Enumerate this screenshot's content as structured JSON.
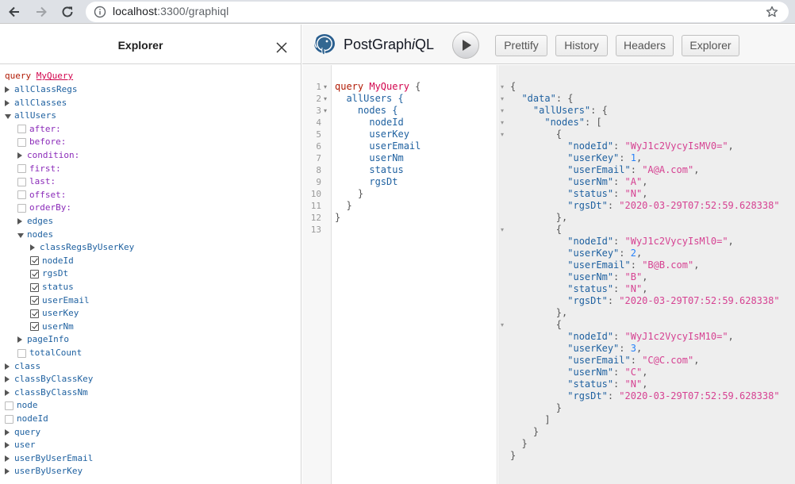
{
  "browser": {
    "url_host": "localhost",
    "url_rest": ":3300/graphiql"
  },
  "explorer": {
    "title": "Explorer",
    "root": {
      "keyword": "query",
      "name": "MyQuery"
    },
    "rows": [
      {
        "t": "allClassRegs",
        "k": "fld",
        "c": "collapsed"
      },
      {
        "t": "allClasses",
        "k": "fld",
        "c": "collapsed"
      },
      {
        "t": "allUsers",
        "k": "fld",
        "c": "expanded"
      },
      {
        "t": "after:",
        "k": "arg",
        "c": "unchecked"
      },
      {
        "t": "before:",
        "k": "arg",
        "c": "unchecked"
      },
      {
        "t": "condition:",
        "k": "arg",
        "c": "collapsed"
      },
      {
        "t": "first:",
        "k": "arg",
        "c": "unchecked"
      },
      {
        "t": "last:",
        "k": "arg",
        "c": "unchecked"
      },
      {
        "t": "offset:",
        "k": "arg",
        "c": "unchecked"
      },
      {
        "t": "orderBy:",
        "k": "arg",
        "c": "unchecked"
      },
      {
        "t": "edges",
        "k": "fld",
        "c": "collapsed"
      },
      {
        "t": "nodes",
        "k": "fld",
        "c": "expanded"
      },
      {
        "t": "classRegsByUserKey",
        "k": "fld",
        "c": "collapsed"
      },
      {
        "t": "nodeId",
        "k": "fld",
        "c": "checked"
      },
      {
        "t": "rgsDt",
        "k": "fld",
        "c": "checked"
      },
      {
        "t": "status",
        "k": "fld",
        "c": "checked"
      },
      {
        "t": "userEmail",
        "k": "fld",
        "c": "checked"
      },
      {
        "t": "userKey",
        "k": "fld",
        "c": "checked"
      },
      {
        "t": "userNm",
        "k": "fld",
        "c": "checked"
      },
      {
        "t": "pageInfo",
        "k": "fld",
        "c": "collapsed"
      },
      {
        "t": "totalCount",
        "k": "fld",
        "c": "unchecked"
      },
      {
        "t": "class",
        "k": "fld",
        "c": "collapsed"
      },
      {
        "t": "classByClassKey",
        "k": "fld",
        "c": "collapsed"
      },
      {
        "t": "classByClassNm",
        "k": "fld",
        "c": "collapsed"
      },
      {
        "t": "node",
        "k": "fld",
        "c": "unchecked"
      },
      {
        "t": "nodeId",
        "k": "fld",
        "c": "unchecked"
      },
      {
        "t": "query",
        "k": "fld",
        "c": "collapsed"
      },
      {
        "t": "user",
        "k": "fld",
        "c": "collapsed"
      },
      {
        "t": "userByUserEmail",
        "k": "fld",
        "c": "collapsed"
      },
      {
        "t": "userByUserKey",
        "k": "fld",
        "c": "collapsed"
      }
    ]
  },
  "toolbar": {
    "brand_prefix": "PostGraph",
    "brand_italic": "i",
    "brand_suffix": "QL",
    "buttons": [
      "Prettify",
      "History",
      "Headers",
      "Explorer"
    ]
  },
  "editor": {
    "lines": [
      [
        {
          "s": "query ",
          "c": "kw"
        },
        {
          "s": "MyQuery",
          "c": "qn"
        },
        {
          "s": " {",
          "c": "p"
        }
      ],
      [
        {
          "s": "  allUsers {",
          "c": "f"
        }
      ],
      [
        {
          "s": "    nodes {",
          "c": "f"
        }
      ],
      [
        {
          "s": "      nodeId",
          "c": "f"
        }
      ],
      [
        {
          "s": "      userKey",
          "c": "f"
        }
      ],
      [
        {
          "s": "      userEmail",
          "c": "f"
        }
      ],
      [
        {
          "s": "      userNm",
          "c": "f"
        }
      ],
      [
        {
          "s": "      status",
          "c": "f"
        }
      ],
      [
        {
          "s": "      rgsDt",
          "c": "f"
        }
      ],
      [
        {
          "s": "    }",
          "c": "p"
        }
      ],
      [
        {
          "s": "  }",
          "c": "p"
        }
      ],
      [
        {
          "s": "}",
          "c": "p"
        }
      ],
      [
        {
          "s": "",
          "c": "p"
        }
      ]
    ],
    "fold_lines": [
      1,
      2,
      3
    ]
  },
  "result": {
    "lines": [
      [
        {
          "s": "{",
          "c": "p"
        }
      ],
      [
        {
          "s": "  ",
          "c": "p"
        },
        {
          "s": "\"data\"",
          "c": "k"
        },
        {
          "s": ": {",
          "c": "p"
        }
      ],
      [
        {
          "s": "    ",
          "c": "p"
        },
        {
          "s": "\"allUsers\"",
          "c": "k"
        },
        {
          "s": ": {",
          "c": "p"
        }
      ],
      [
        {
          "s": "      ",
          "c": "p"
        },
        {
          "s": "\"nodes\"",
          "c": "k"
        },
        {
          "s": ": [",
          "c": "p"
        }
      ],
      [
        {
          "s": "        {",
          "c": "p"
        }
      ],
      [
        {
          "s": "          ",
          "c": "p"
        },
        {
          "s": "\"nodeId\"",
          "c": "k"
        },
        {
          "s": ": ",
          "c": "p"
        },
        {
          "s": "\"WyJ1c2VycyIsMV0=\"",
          "c": "s"
        },
        {
          "s": ",",
          "c": "p"
        }
      ],
      [
        {
          "s": "          ",
          "c": "p"
        },
        {
          "s": "\"userKey\"",
          "c": "k"
        },
        {
          "s": ": ",
          "c": "p"
        },
        {
          "s": "1",
          "c": "n"
        },
        {
          "s": ",",
          "c": "p"
        }
      ],
      [
        {
          "s": "          ",
          "c": "p"
        },
        {
          "s": "\"userEmail\"",
          "c": "k"
        },
        {
          "s": ": ",
          "c": "p"
        },
        {
          "s": "\"A@A.com\"",
          "c": "s"
        },
        {
          "s": ",",
          "c": "p"
        }
      ],
      [
        {
          "s": "          ",
          "c": "p"
        },
        {
          "s": "\"userNm\"",
          "c": "k"
        },
        {
          "s": ": ",
          "c": "p"
        },
        {
          "s": "\"A\"",
          "c": "s"
        },
        {
          "s": ",",
          "c": "p"
        }
      ],
      [
        {
          "s": "          ",
          "c": "p"
        },
        {
          "s": "\"status\"",
          "c": "k"
        },
        {
          "s": ": ",
          "c": "p"
        },
        {
          "s": "\"N\"",
          "c": "s"
        },
        {
          "s": ",",
          "c": "p"
        }
      ],
      [
        {
          "s": "          ",
          "c": "p"
        },
        {
          "s": "\"rgsDt\"",
          "c": "k"
        },
        {
          "s": ": ",
          "c": "p"
        },
        {
          "s": "\"2020-03-29T07:52:59.628338\"",
          "c": "s"
        }
      ],
      [
        {
          "s": "        },",
          "c": "p"
        }
      ],
      [
        {
          "s": "        {",
          "c": "p"
        }
      ],
      [
        {
          "s": "          ",
          "c": "p"
        },
        {
          "s": "\"nodeId\"",
          "c": "k"
        },
        {
          "s": ": ",
          "c": "p"
        },
        {
          "s": "\"WyJ1c2VycyIsMl0=\"",
          "c": "s"
        },
        {
          "s": ",",
          "c": "p"
        }
      ],
      [
        {
          "s": "          ",
          "c": "p"
        },
        {
          "s": "\"userKey\"",
          "c": "k"
        },
        {
          "s": ": ",
          "c": "p"
        },
        {
          "s": "2",
          "c": "n"
        },
        {
          "s": ",",
          "c": "p"
        }
      ],
      [
        {
          "s": "          ",
          "c": "p"
        },
        {
          "s": "\"userEmail\"",
          "c": "k"
        },
        {
          "s": ": ",
          "c": "p"
        },
        {
          "s": "\"B@B.com\"",
          "c": "s"
        },
        {
          "s": ",",
          "c": "p"
        }
      ],
      [
        {
          "s": "          ",
          "c": "p"
        },
        {
          "s": "\"userNm\"",
          "c": "k"
        },
        {
          "s": ": ",
          "c": "p"
        },
        {
          "s": "\"B\"",
          "c": "s"
        },
        {
          "s": ",",
          "c": "p"
        }
      ],
      [
        {
          "s": "          ",
          "c": "p"
        },
        {
          "s": "\"status\"",
          "c": "k"
        },
        {
          "s": ": ",
          "c": "p"
        },
        {
          "s": "\"N\"",
          "c": "s"
        },
        {
          "s": ",",
          "c": "p"
        }
      ],
      [
        {
          "s": "          ",
          "c": "p"
        },
        {
          "s": "\"rgsDt\"",
          "c": "k"
        },
        {
          "s": ": ",
          "c": "p"
        },
        {
          "s": "\"2020-03-29T07:52:59.628338\"",
          "c": "s"
        }
      ],
      [
        {
          "s": "        },",
          "c": "p"
        }
      ],
      [
        {
          "s": "        {",
          "c": "p"
        }
      ],
      [
        {
          "s": "          ",
          "c": "p"
        },
        {
          "s": "\"nodeId\"",
          "c": "k"
        },
        {
          "s": ": ",
          "c": "p"
        },
        {
          "s": "\"WyJ1c2VycyIsM10=\"",
          "c": "s"
        },
        {
          "s": ",",
          "c": "p"
        }
      ],
      [
        {
          "s": "          ",
          "c": "p"
        },
        {
          "s": "\"userKey\"",
          "c": "k"
        },
        {
          "s": ": ",
          "c": "p"
        },
        {
          "s": "3",
          "c": "n"
        },
        {
          "s": ",",
          "c": "p"
        }
      ],
      [
        {
          "s": "          ",
          "c": "p"
        },
        {
          "s": "\"userEmail\"",
          "c": "k"
        },
        {
          "s": ": ",
          "c": "p"
        },
        {
          "s": "\"C@C.com\"",
          "c": "s"
        },
        {
          "s": ",",
          "c": "p"
        }
      ],
      [
        {
          "s": "          ",
          "c": "p"
        },
        {
          "s": "\"userNm\"",
          "c": "k"
        },
        {
          "s": ": ",
          "c": "p"
        },
        {
          "s": "\"C\"",
          "c": "s"
        },
        {
          "s": ",",
          "c": "p"
        }
      ],
      [
        {
          "s": "          ",
          "c": "p"
        },
        {
          "s": "\"status\"",
          "c": "k"
        },
        {
          "s": ": ",
          "c": "p"
        },
        {
          "s": "\"N\"",
          "c": "s"
        },
        {
          "s": ",",
          "c": "p"
        }
      ],
      [
        {
          "s": "          ",
          "c": "p"
        },
        {
          "s": "\"rgsDt\"",
          "c": "k"
        },
        {
          "s": ": ",
          "c": "p"
        },
        {
          "s": "\"2020-03-29T07:52:59.628338\"",
          "c": "s"
        }
      ],
      [
        {
          "s": "        }",
          "c": "p"
        }
      ],
      [
        {
          "s": "      ]",
          "c": "p"
        }
      ],
      [
        {
          "s": "    }",
          "c": "p"
        }
      ],
      [
        {
          "s": "  }",
          "c": "p"
        }
      ],
      [
        {
          "s": "}",
          "c": "p"
        }
      ]
    ],
    "fold_lines": [
      0,
      1,
      2,
      3,
      4,
      12,
      20
    ]
  },
  "icons": {
    "back": "arrow-left-icon",
    "forward": "arrow-right-icon",
    "reload": "reload-icon",
    "info": "info-icon",
    "star": "star-icon",
    "close": "close-icon",
    "run": "play-icon",
    "logo": "elephant-logo-icon"
  }
}
